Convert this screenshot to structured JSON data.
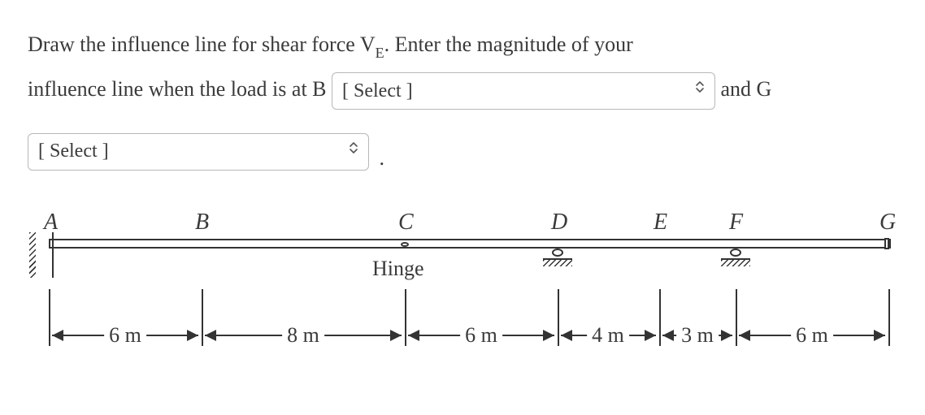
{
  "question": {
    "part1": "Draw the influence line for shear force V",
    "subE": "E",
    "part2": ". Enter the magnitude of your",
    "part3": "influence line when the load is at B",
    "part4": " and G"
  },
  "selects": {
    "placeholder1": "[ Select ]",
    "placeholder2": "[ Select ]"
  },
  "period": ".",
  "diagram": {
    "labels": {
      "A": "A",
      "B": "B",
      "C": "C",
      "D": "D",
      "E": "E",
      "F": "F",
      "G": "G"
    },
    "hinge": "Hinge",
    "dims": {
      "AB": "6 m",
      "BC": "8 m",
      "CD": "6 m",
      "DE": "4 m",
      "EF": "3 m",
      "FG": "6 m"
    }
  }
}
